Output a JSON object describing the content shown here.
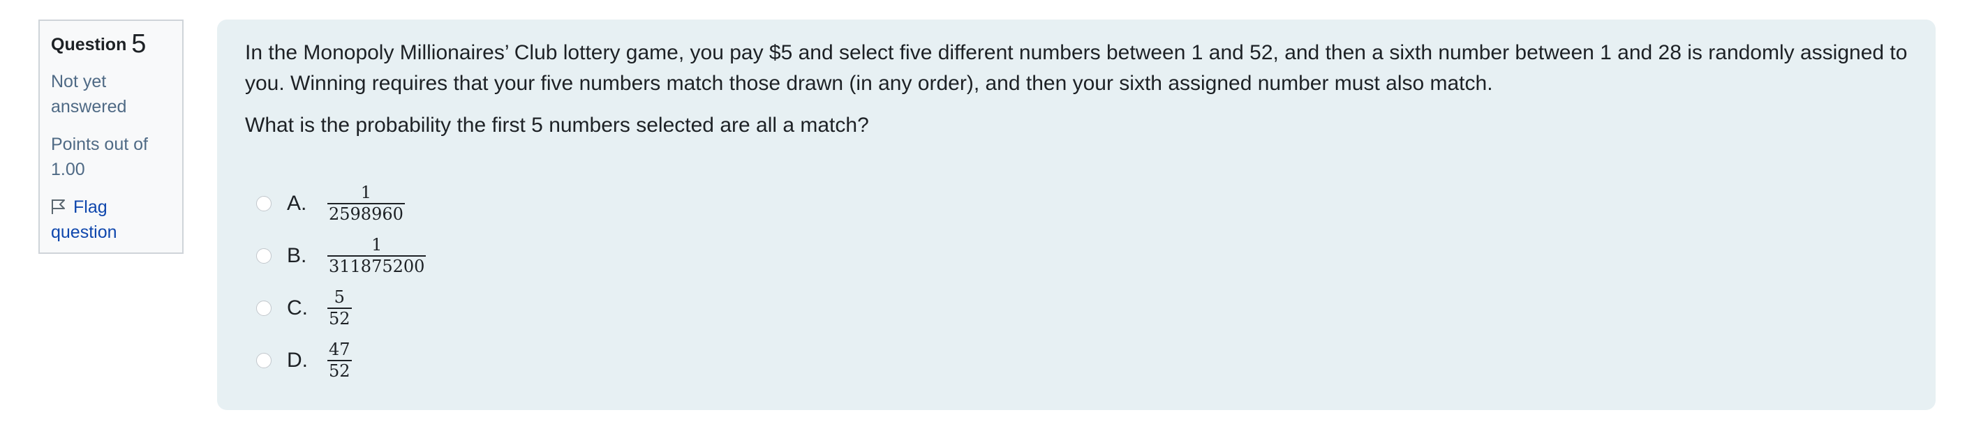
{
  "question_info": {
    "label": "Question",
    "number": "5",
    "state": "Not yet answered",
    "grade": "Points out of 1.00",
    "flag_label": "Flag question"
  },
  "question": {
    "text": "In the Monopoly Millionaires’ Club lottery game, you pay $5 and select five different numbers between 1 and 52, and then a sixth number between 1 and 28 is randomly assigned to you. Winning requires that your five numbers match those drawn (in any order), and then your sixth assigned number must also match.",
    "prompt": "What is the probability the first 5 numbers selected are all a match?"
  },
  "answers": [
    {
      "letter": "A.",
      "numerator": "1",
      "denominator": "2598960"
    },
    {
      "letter": "B.",
      "numerator": "1",
      "denominator": "311875200"
    },
    {
      "letter": "C.",
      "numerator": "5",
      "denominator": "52"
    },
    {
      "letter": "D.",
      "numerator": "47",
      "denominator": "52"
    }
  ],
  "colors": {
    "content_background": "#e7f0f3",
    "info_background": "#f8f9fa",
    "link": "#0f47ad",
    "muted": "#4f6a85",
    "text": "#1d2125"
  },
  "icons": {
    "flag": "flag-icon"
  }
}
